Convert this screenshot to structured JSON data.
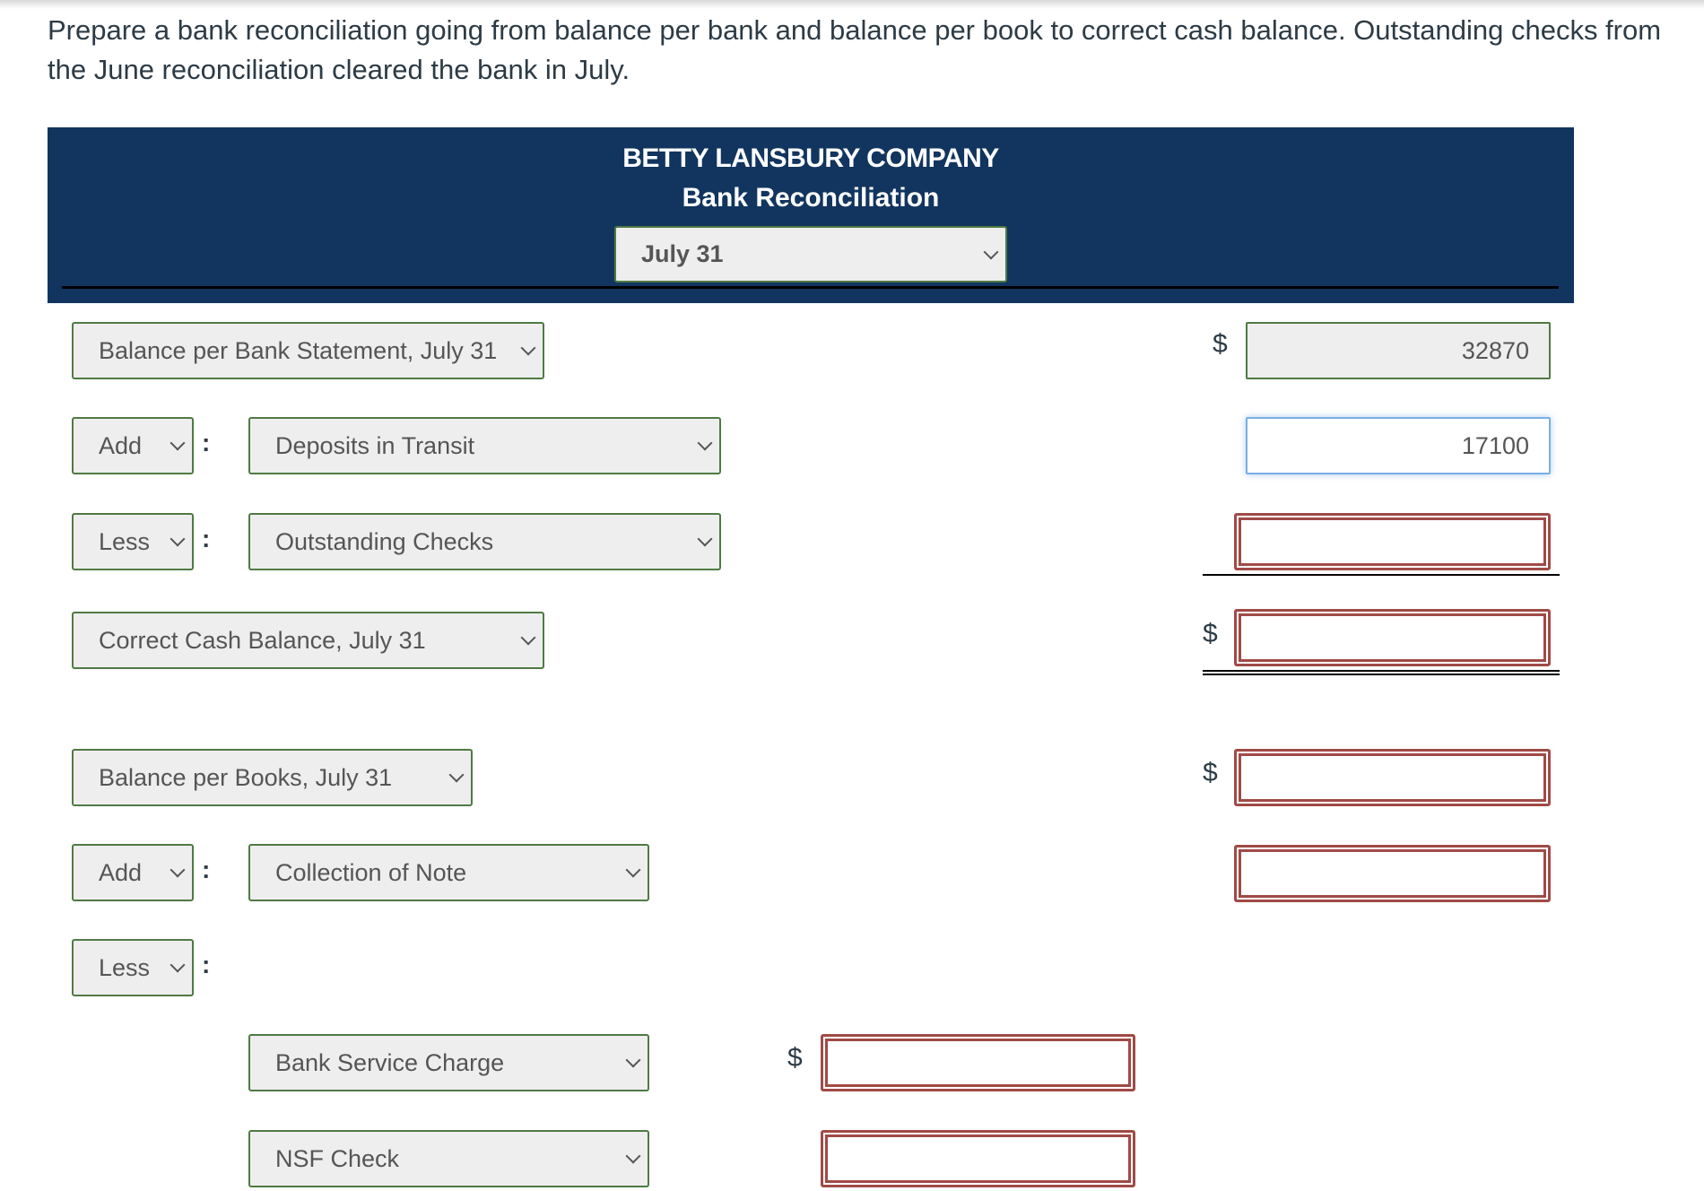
{
  "prompt": "Prepare a bank reconciliation going from balance per bank and balance per book to correct cash balance. Outstanding checks from the June reconciliation cleared the bank in July.",
  "header": {
    "company": "BETTY LANSBURY COMPANY",
    "statement": "Bank Reconciliation",
    "date_select": "July 31"
  },
  "currency_symbol": "$",
  "bank_section": {
    "balance_label": "Balance per Bank Statement, July 31",
    "balance_value": "32870",
    "add_operator": "Add",
    "add_item": "Deposits in Transit",
    "add_value": "17100",
    "less_operator": "Less",
    "less_item": "Outstanding Checks",
    "less_value": "",
    "correct_label": "Correct Cash Balance, July 31",
    "correct_value": ""
  },
  "book_section": {
    "balance_label": "Balance per Books, July 31",
    "balance_value": "",
    "add_operator": "Add",
    "add_item": "Collection of Note",
    "add_value": "",
    "less_operator": "Less",
    "less_items": [
      {
        "label": "Bank Service Charge",
        "value": ""
      },
      {
        "label": "NSF Check",
        "value": ""
      }
    ]
  },
  "colors": {
    "header_bg": "#12355f",
    "select_border": "#4f7a43",
    "error_border": "#a04a46",
    "focus_border": "#7aaee6"
  }
}
